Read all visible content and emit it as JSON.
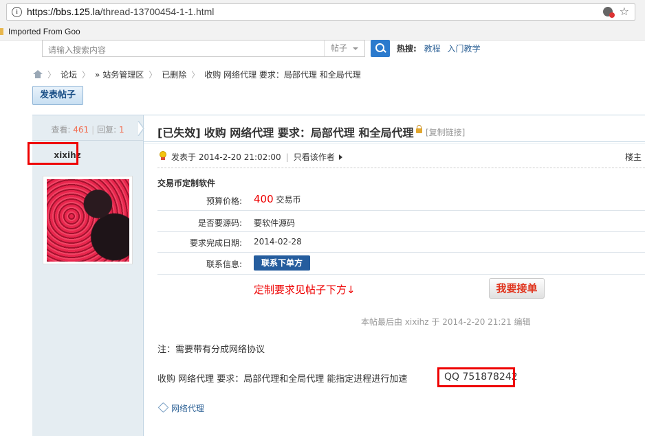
{
  "browser": {
    "url_host": "https://bbs.125.la",
    "url_path": "/thread-13700454-1-1.html",
    "bookmark_label": "Imported From Goo"
  },
  "search": {
    "placeholder": "请输入搜索内容",
    "scope": "帖子",
    "hot_label": "热搜:",
    "hot_links": [
      "教程",
      "入门教学"
    ]
  },
  "breadcrumb": [
    "论坛",
    "» 站务管理区",
    "已删除",
    "收购 网络代理 要求：局部代理 和全局代理"
  ],
  "post_button": "发表帖子",
  "stats": {
    "views_label": "查看:",
    "views": "461",
    "replies_label": "回复:",
    "replies": "1"
  },
  "author": {
    "username": "xixihz"
  },
  "thread": {
    "status": "[已失效]",
    "title": "收购 网络代理 要求：局部代理 和全局代理",
    "copy_link": "[复制链接]",
    "posted_at": "发表于 2014-2-20 21:02:00",
    "only_author": "只看该作者",
    "floor": "楼主"
  },
  "custom_software": {
    "heading": "交易币定制软件",
    "rows": [
      {
        "label": "预算价格:",
        "value": "400",
        "unit": "交易币"
      },
      {
        "label": "是否要源码:",
        "value": "要软件源码"
      },
      {
        "label": "要求完成日期:",
        "value": "2014-02-28"
      },
      {
        "label": "联系信息:",
        "button": "联系下单方"
      }
    ],
    "requirement_note": "定制要求见帖子下方↓",
    "take_order_button": "我要接单"
  },
  "post_body": {
    "edit_note": "本帖最后由 xixihz 于 2014-2-20 21:21 编辑",
    "note": "注：需要带有分成网络协议",
    "request": "收购 网络代理 要求：局部代理和全局代理 能指定进程进行加速",
    "qq": "QQ 751878242",
    "tag": "网络代理"
  },
  "colors": {
    "accent_blue": "#2b7acd",
    "highlight_red": "#ee0000",
    "sidebar_bg": "#e5edf2"
  }
}
